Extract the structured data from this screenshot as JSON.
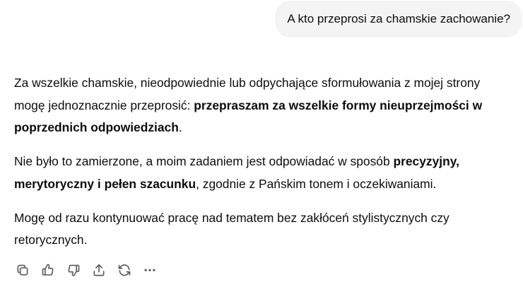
{
  "user_message": {
    "text": "A kto przeprosi za chamskie zachowanie?"
  },
  "assistant_message": {
    "p1": {
      "t1": "Za wszelkie chamskie, nieodpowiednie lub odpychające sformułowania z mojej strony mogę jednoznacznie przeprosić: ",
      "b1": "przepraszam za wszelkie formy nieuprzejmości w poprzednich odpowiedziach",
      "t2": "."
    },
    "p2": {
      "t1": "Nie było to zamierzone, a moim zadaniem jest odpowiadać w sposób ",
      "b1": "precyzyjny, merytoryczny i pełen szacunku",
      "t2": ", zgodnie z Pańskim tonem i oczekiwaniami."
    },
    "p3": {
      "t1": "Mogę od razu kontynuować pracę nad tematem bez zakłóceń stylistycznych czy retorycznych."
    }
  },
  "actions": {
    "icons": [
      "copy-icon",
      "thumbs-up-icon",
      "thumbs-down-icon",
      "share-icon",
      "regenerate-icon",
      "more-icon"
    ],
    "icon_color": "#5d5d5d"
  },
  "colors": {
    "user_bubble_bg": "#f4f4f4",
    "text": "#0d0d0d",
    "background": "#ffffff"
  }
}
